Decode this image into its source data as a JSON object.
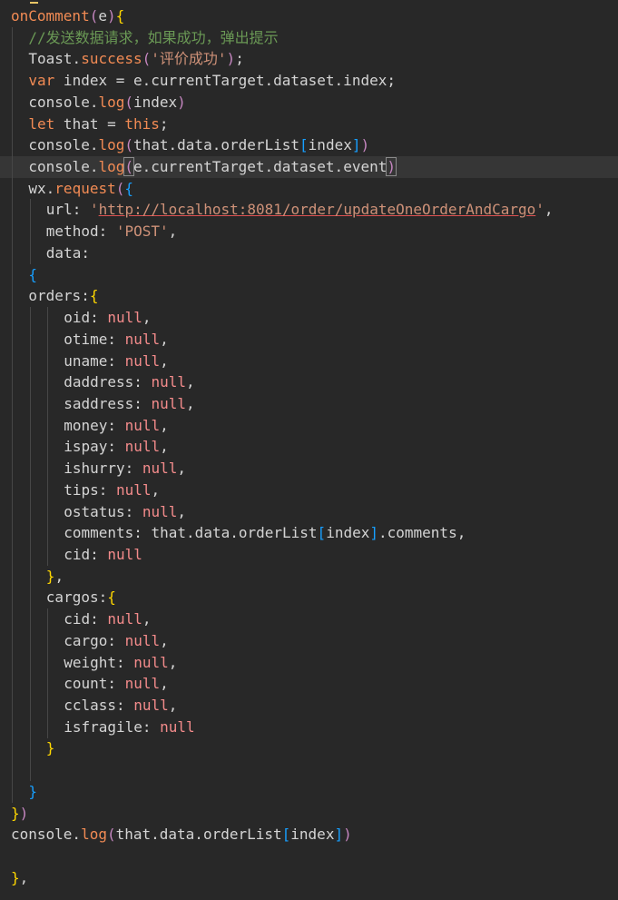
{
  "editor": {
    "background": "#282828",
    "current_line_background": "#363636",
    "lines": [
      {
        "indent": 0,
        "tokens": [
          [
            "t-fn",
            "onComment"
          ],
          [
            "t-paren",
            "("
          ],
          [
            "t-var",
            "e"
          ],
          [
            "t-paren",
            ")"
          ],
          [
            "t-brace",
            "{"
          ]
        ]
      },
      {
        "indent": 1,
        "tokens": [
          [
            "t-comment",
            "//发送数据请求，如果成功，弹出提示"
          ]
        ]
      },
      {
        "indent": 1,
        "tokens": [
          [
            "t-var",
            "Toast."
          ],
          [
            "t-method",
            "success"
          ],
          [
            "t-paren",
            "("
          ],
          [
            "t-str",
            "'评价成功'"
          ],
          [
            "t-paren",
            ")"
          ],
          [
            "t-var",
            ";"
          ]
        ]
      },
      {
        "indent": 1,
        "tokens": [
          [
            "t-kw",
            "var"
          ],
          [
            "t-var",
            " index = e.currentTarget.dataset.index;"
          ]
        ]
      },
      {
        "indent": 1,
        "tokens": [
          [
            "t-var",
            "console."
          ],
          [
            "t-method",
            "log"
          ],
          [
            "t-paren",
            "("
          ],
          [
            "t-var",
            "index"
          ],
          [
            "t-paren",
            ")"
          ]
        ]
      },
      {
        "indent": 1,
        "tokens": [
          [
            "t-kw",
            "let"
          ],
          [
            "t-var",
            " that = "
          ],
          [
            "t-kw",
            "this"
          ],
          [
            "t-var",
            ";"
          ]
        ]
      },
      {
        "indent": 1,
        "tokens": [
          [
            "t-var",
            "console."
          ],
          [
            "t-method",
            "log"
          ],
          [
            "t-paren",
            "("
          ],
          [
            "t-var",
            "that.data.orderList"
          ],
          [
            "t-brace2",
            "["
          ],
          [
            "t-var",
            "index"
          ],
          [
            "t-brace2",
            "]"
          ],
          [
            "t-paren",
            ")"
          ]
        ]
      },
      {
        "indent": 1,
        "current": true,
        "tokens": [
          [
            "t-var",
            "console."
          ],
          [
            "t-method",
            "log"
          ],
          [
            "t-paren t-match",
            "("
          ],
          [
            "t-var",
            "e.currentTarget.dataset.event"
          ],
          [
            "t-paren t-match",
            ")"
          ]
        ]
      },
      {
        "indent": 1,
        "tokens": [
          [
            "t-var",
            "wx."
          ],
          [
            "t-method",
            "request"
          ],
          [
            "t-paren",
            "("
          ],
          [
            "t-brace2",
            "{"
          ]
        ]
      },
      {
        "indent": 2,
        "tokens": [
          [
            "t-var",
            "url: "
          ],
          [
            "t-str",
            "'"
          ],
          [
            "t-url",
            "http://localhost:8081/order/updateOneOrderAndCargo"
          ],
          [
            "t-str",
            "'"
          ],
          [
            "t-var",
            ","
          ]
        ]
      },
      {
        "indent": 2,
        "tokens": [
          [
            "t-var",
            "method: "
          ],
          [
            "t-str",
            "'POST'"
          ],
          [
            "t-var",
            ","
          ]
        ]
      },
      {
        "indent": 2,
        "tokens": [
          [
            "t-var",
            "data:"
          ]
        ]
      },
      {
        "indent": 1,
        "tokens": [
          [
            "t-brace2",
            "{"
          ]
        ]
      },
      {
        "indent": 1,
        "tokens": [
          [
            "t-var",
            "orders:"
          ],
          [
            "t-brace",
            "{"
          ]
        ]
      },
      {
        "indent": 3,
        "tokens": [
          [
            "t-var",
            "oid: "
          ],
          [
            "t-null",
            "null"
          ],
          [
            "t-var",
            ","
          ]
        ]
      },
      {
        "indent": 3,
        "tokens": [
          [
            "t-var",
            "otime: "
          ],
          [
            "t-null",
            "null"
          ],
          [
            "t-var",
            ","
          ]
        ]
      },
      {
        "indent": 3,
        "tokens": [
          [
            "t-var",
            "uname: "
          ],
          [
            "t-null",
            "null"
          ],
          [
            "t-var",
            ","
          ]
        ]
      },
      {
        "indent": 3,
        "tokens": [
          [
            "t-var",
            "daddress: "
          ],
          [
            "t-null",
            "null"
          ],
          [
            "t-var",
            ","
          ]
        ]
      },
      {
        "indent": 3,
        "tokens": [
          [
            "t-var",
            "saddress: "
          ],
          [
            "t-null",
            "null"
          ],
          [
            "t-var",
            ","
          ]
        ]
      },
      {
        "indent": 3,
        "tokens": [
          [
            "t-var",
            "money: "
          ],
          [
            "t-null",
            "null"
          ],
          [
            "t-var",
            ","
          ]
        ]
      },
      {
        "indent": 3,
        "tokens": [
          [
            "t-var",
            "ispay: "
          ],
          [
            "t-null",
            "null"
          ],
          [
            "t-var",
            ","
          ]
        ]
      },
      {
        "indent": 3,
        "tokens": [
          [
            "t-var",
            "ishurry: "
          ],
          [
            "t-null",
            "null"
          ],
          [
            "t-var",
            ","
          ]
        ]
      },
      {
        "indent": 3,
        "tokens": [
          [
            "t-var",
            "tips: "
          ],
          [
            "t-null",
            "null"
          ],
          [
            "t-var",
            ","
          ]
        ]
      },
      {
        "indent": 3,
        "tokens": [
          [
            "t-var",
            "ostatus: "
          ],
          [
            "t-null",
            "null"
          ],
          [
            "t-var",
            ","
          ]
        ]
      },
      {
        "indent": 3,
        "tokens": [
          [
            "t-var",
            "comments: that.data.orderList"
          ],
          [
            "t-brace2",
            "["
          ],
          [
            "t-var",
            "index"
          ],
          [
            "t-brace2",
            "]"
          ],
          [
            "t-var",
            ".comments,"
          ]
        ]
      },
      {
        "indent": 3,
        "tokens": [
          [
            "t-var",
            "cid: "
          ],
          [
            "t-null",
            "null"
          ]
        ]
      },
      {
        "indent": 2,
        "tokens": [
          [
            "t-brace",
            "}"
          ],
          [
            "t-var",
            ","
          ]
        ]
      },
      {
        "indent": 2,
        "tokens": [
          [
            "t-var",
            "cargos:"
          ],
          [
            "t-brace",
            "{"
          ]
        ]
      },
      {
        "indent": 3,
        "tokens": [
          [
            "t-var",
            "cid: "
          ],
          [
            "t-null",
            "null"
          ],
          [
            "t-var",
            ","
          ]
        ]
      },
      {
        "indent": 3,
        "tokens": [
          [
            "t-var",
            "cargo: "
          ],
          [
            "t-null",
            "null"
          ],
          [
            "t-var",
            ","
          ]
        ]
      },
      {
        "indent": 3,
        "tokens": [
          [
            "t-var",
            "weight: "
          ],
          [
            "t-null",
            "null"
          ],
          [
            "t-var",
            ","
          ]
        ]
      },
      {
        "indent": 3,
        "tokens": [
          [
            "t-var",
            "count: "
          ],
          [
            "t-null",
            "null"
          ],
          [
            "t-var",
            ","
          ]
        ]
      },
      {
        "indent": 3,
        "tokens": [
          [
            "t-var",
            "cclass: "
          ],
          [
            "t-null",
            "null"
          ],
          [
            "t-var",
            ","
          ]
        ]
      },
      {
        "indent": 3,
        "tokens": [
          [
            "t-var",
            "isfragile: "
          ],
          [
            "t-null",
            "null"
          ]
        ]
      },
      {
        "indent": 2,
        "tokens": [
          [
            "t-brace",
            "}"
          ]
        ]
      },
      {
        "indent": 2,
        "tokens": []
      },
      {
        "indent": 1,
        "tokens": [
          [
            "t-brace2",
            "}"
          ]
        ]
      },
      {
        "indent": 0,
        "tokens": [
          [
            "t-brace",
            "}"
          ],
          [
            "t-paren",
            ")"
          ]
        ]
      },
      {
        "indent": 0,
        "tokens": [
          [
            "t-var",
            "console."
          ],
          [
            "t-method",
            "log"
          ],
          [
            "t-paren",
            "("
          ],
          [
            "t-var",
            "that.data.orderList"
          ],
          [
            "t-brace2",
            "["
          ],
          [
            "t-var",
            "index"
          ],
          [
            "t-brace2",
            "]"
          ],
          [
            "t-paren",
            ")"
          ]
        ]
      },
      {
        "indent": 0,
        "tokens": []
      },
      {
        "indent": 0,
        "tokens": [
          [
            "t-brace",
            "}"
          ],
          [
            "t-var",
            ","
          ]
        ]
      }
    ]
  }
}
